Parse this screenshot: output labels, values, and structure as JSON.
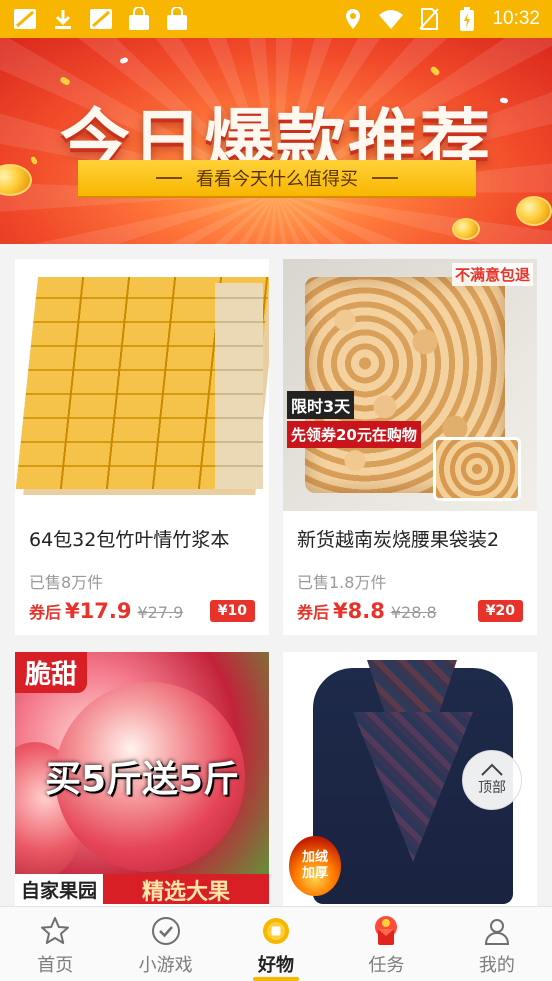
{
  "status_bar": {
    "time": "10:32",
    "icons": [
      "notification-app-icon",
      "download-icon",
      "notification-app-icon",
      "shopping-bag-icon",
      "shopping-bag-icon",
      "location-icon",
      "wifi-icon",
      "no-sim-icon",
      "battery-charging-icon"
    ]
  },
  "banner": {
    "title": "今日爆款推荐",
    "subtitle": "看看今天什么值得买"
  },
  "products": [
    {
      "title": "64包32包竹叶情竹浆本",
      "sold": "已售8万件",
      "price_label": "券后",
      "price": "¥17.9",
      "original_price": "¥27.9",
      "coupon": "¥10"
    },
    {
      "title": "新货越南炭烧腰果袋装2",
      "sold": "已售1.8万件",
      "price_label": "券后",
      "price": "¥8.8",
      "original_price": "¥28.8",
      "coupon": "¥20",
      "image_tags": {
        "corner": "不满意包退",
        "limited": "限时3天",
        "coupon_text": "先领券20元在购物"
      }
    },
    {
      "image_tags": {
        "sweet": "脆甜",
        "promo": "买5斤送5斤",
        "farm": "自家果园",
        "pick": "精选大果"
      }
    },
    {
      "image_tags": {
        "fleece_line1": "加绒",
        "fleece_line2": "加厚"
      }
    }
  ],
  "back_to_top": {
    "label": "顶部"
  },
  "bottom_nav": [
    {
      "label": "首页",
      "icon": "star-icon"
    },
    {
      "label": "小游戏",
      "icon": "check-circle-icon"
    },
    {
      "label": "好物",
      "icon": "goods-coin-icon",
      "active": true
    },
    {
      "label": "任务",
      "icon": "red-envelope-icon"
    },
    {
      "label": "我的",
      "icon": "person-icon"
    }
  ],
  "colors": {
    "brand": "#f8b600",
    "price": "#e8332a",
    "text_muted": "#9a9a9a"
  }
}
